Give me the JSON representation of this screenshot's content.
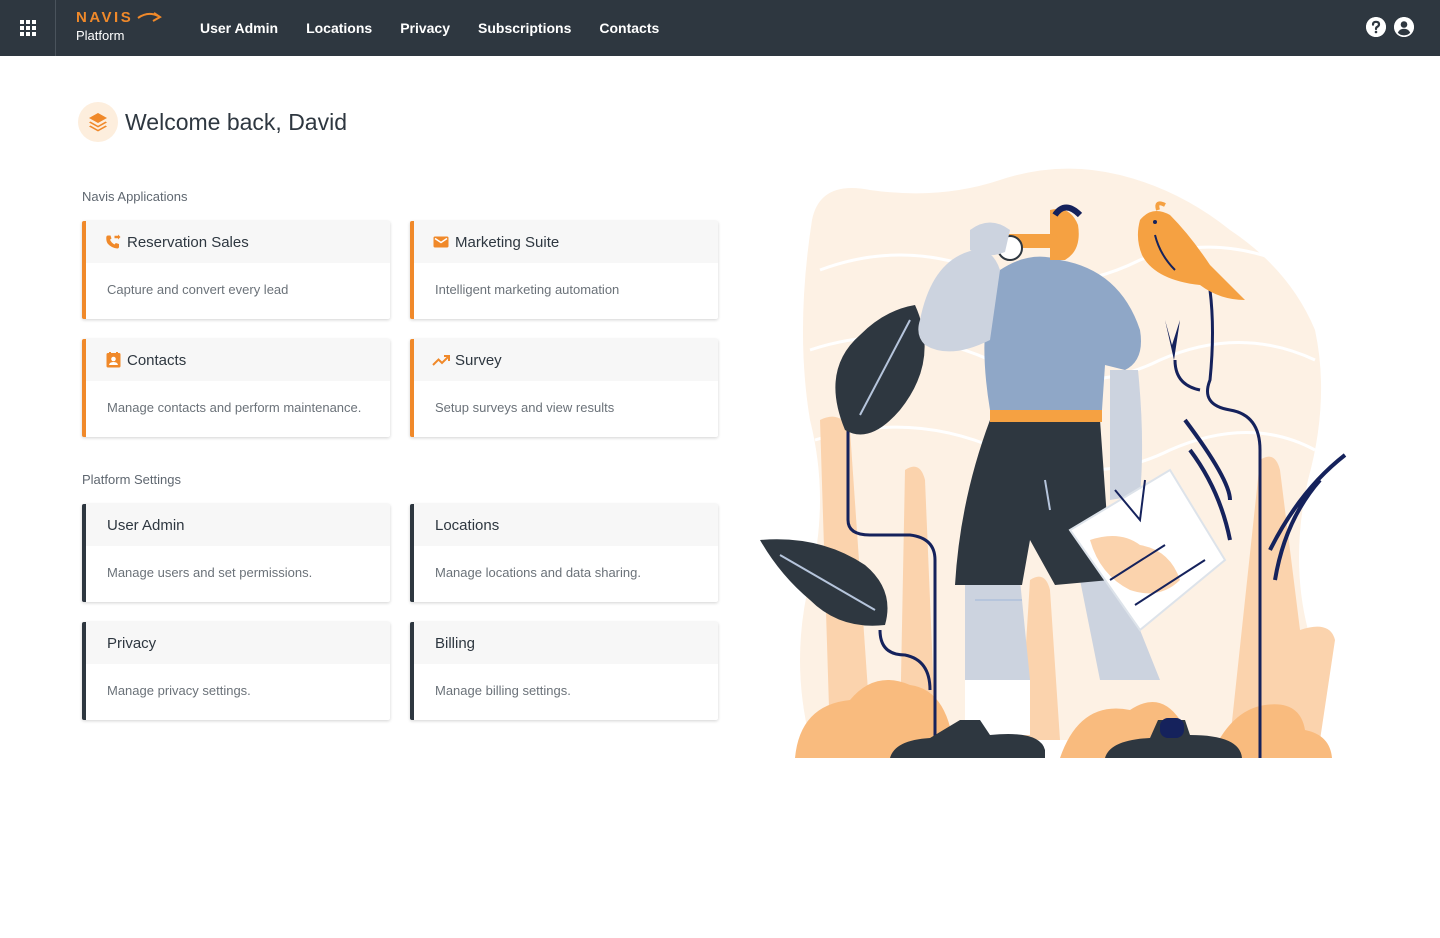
{
  "header": {
    "brand_name": "NAVIS",
    "brand_sub": "Platform",
    "nav": [
      "User Admin",
      "Locations",
      "Privacy",
      "Subscriptions",
      "Contacts"
    ],
    "help_icon": "question-circle-icon",
    "account_icon": "user-circle-icon"
  },
  "welcome": {
    "title": "Welcome back, David",
    "icon": "layers-icon"
  },
  "sections": {
    "applications": "Navis Applications",
    "settings": "Platform Settings"
  },
  "applications": [
    {
      "title": "Reservation Sales",
      "desc": "Capture and convert every lead",
      "icon": "phone-forward-icon"
    },
    {
      "title": "Marketing Suite",
      "desc": "Intelligent marketing automation",
      "icon": "envelope-icon"
    },
    {
      "title": "Contacts",
      "desc": "Manage contacts and perform maintenance.",
      "icon": "contact-card-icon"
    },
    {
      "title": "Survey",
      "desc": "Setup surveys and view results",
      "icon": "trending-up-icon"
    }
  ],
  "settings": [
    {
      "title": "User Admin",
      "desc": "Manage users and set permissions."
    },
    {
      "title": "Locations",
      "desc": "Manage locations and data sharing."
    },
    {
      "title": "Privacy",
      "desc": "Manage privacy settings."
    },
    {
      "title": "Billing",
      "desc": "Manage billing settings."
    }
  ],
  "colors": {
    "accent": "#f0892a",
    "topbar": "#2e3740",
    "navy": "#15225c",
    "peach": "#fde9d6"
  }
}
